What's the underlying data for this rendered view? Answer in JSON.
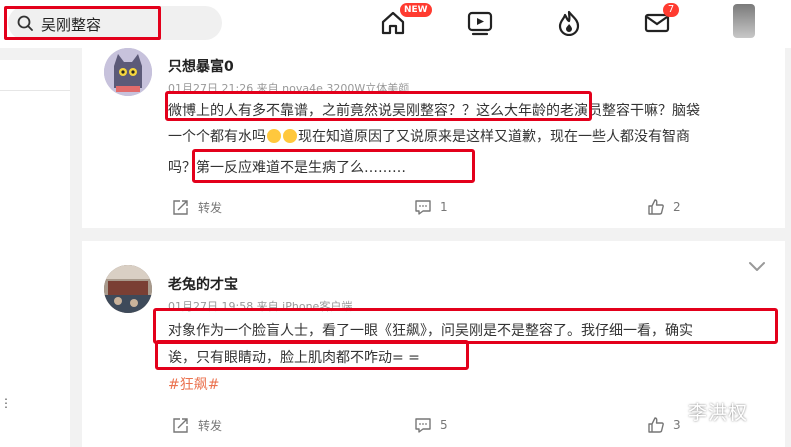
{
  "search": {
    "query": "吴刚整容"
  },
  "nav": {
    "new_badge": "NEW",
    "messages_count": "7"
  },
  "comments": [
    {
      "username": "只想暴富0",
      "meta": "01月27日 21:26 来自 nova4e 3200W立体美颜",
      "lines": [
        {
          "text": "微博上的人有多不靠谱，之前竟然说吴刚整容？？这么大年龄的老演员整容干嘛？脑袋"
        },
        {
          "before": "一个个都有水吗",
          "after": "现在知道原因了又说原来是这样又道歉，现在一些人都没有智商"
        },
        {
          "text": "吗？第一反应难道不是生病了么………"
        }
      ],
      "actions": {
        "repost": "转发",
        "comments": "1",
        "likes": "2"
      }
    },
    {
      "username": "老兔的才宝",
      "meta": "01月27日 19:58 来自 iPhone客户端",
      "lines": [
        {
          "text": "对象作为一个脸盲人士，看了一眼《狂飙》，问吴刚是不是整容了。我仔细一看，确实"
        },
        {
          "text": "诶，只有眼睛动，脸上肌肉都不咋动= ="
        }
      ],
      "topic": "#狂飙#",
      "actions": {
        "repost": "转发",
        "comments": "5",
        "likes": "3"
      }
    }
  ],
  "watermark": "李洪权",
  "colors": {
    "highlight": "#e3001b",
    "topic": "#eb7350",
    "badge": "#ff3b30"
  }
}
